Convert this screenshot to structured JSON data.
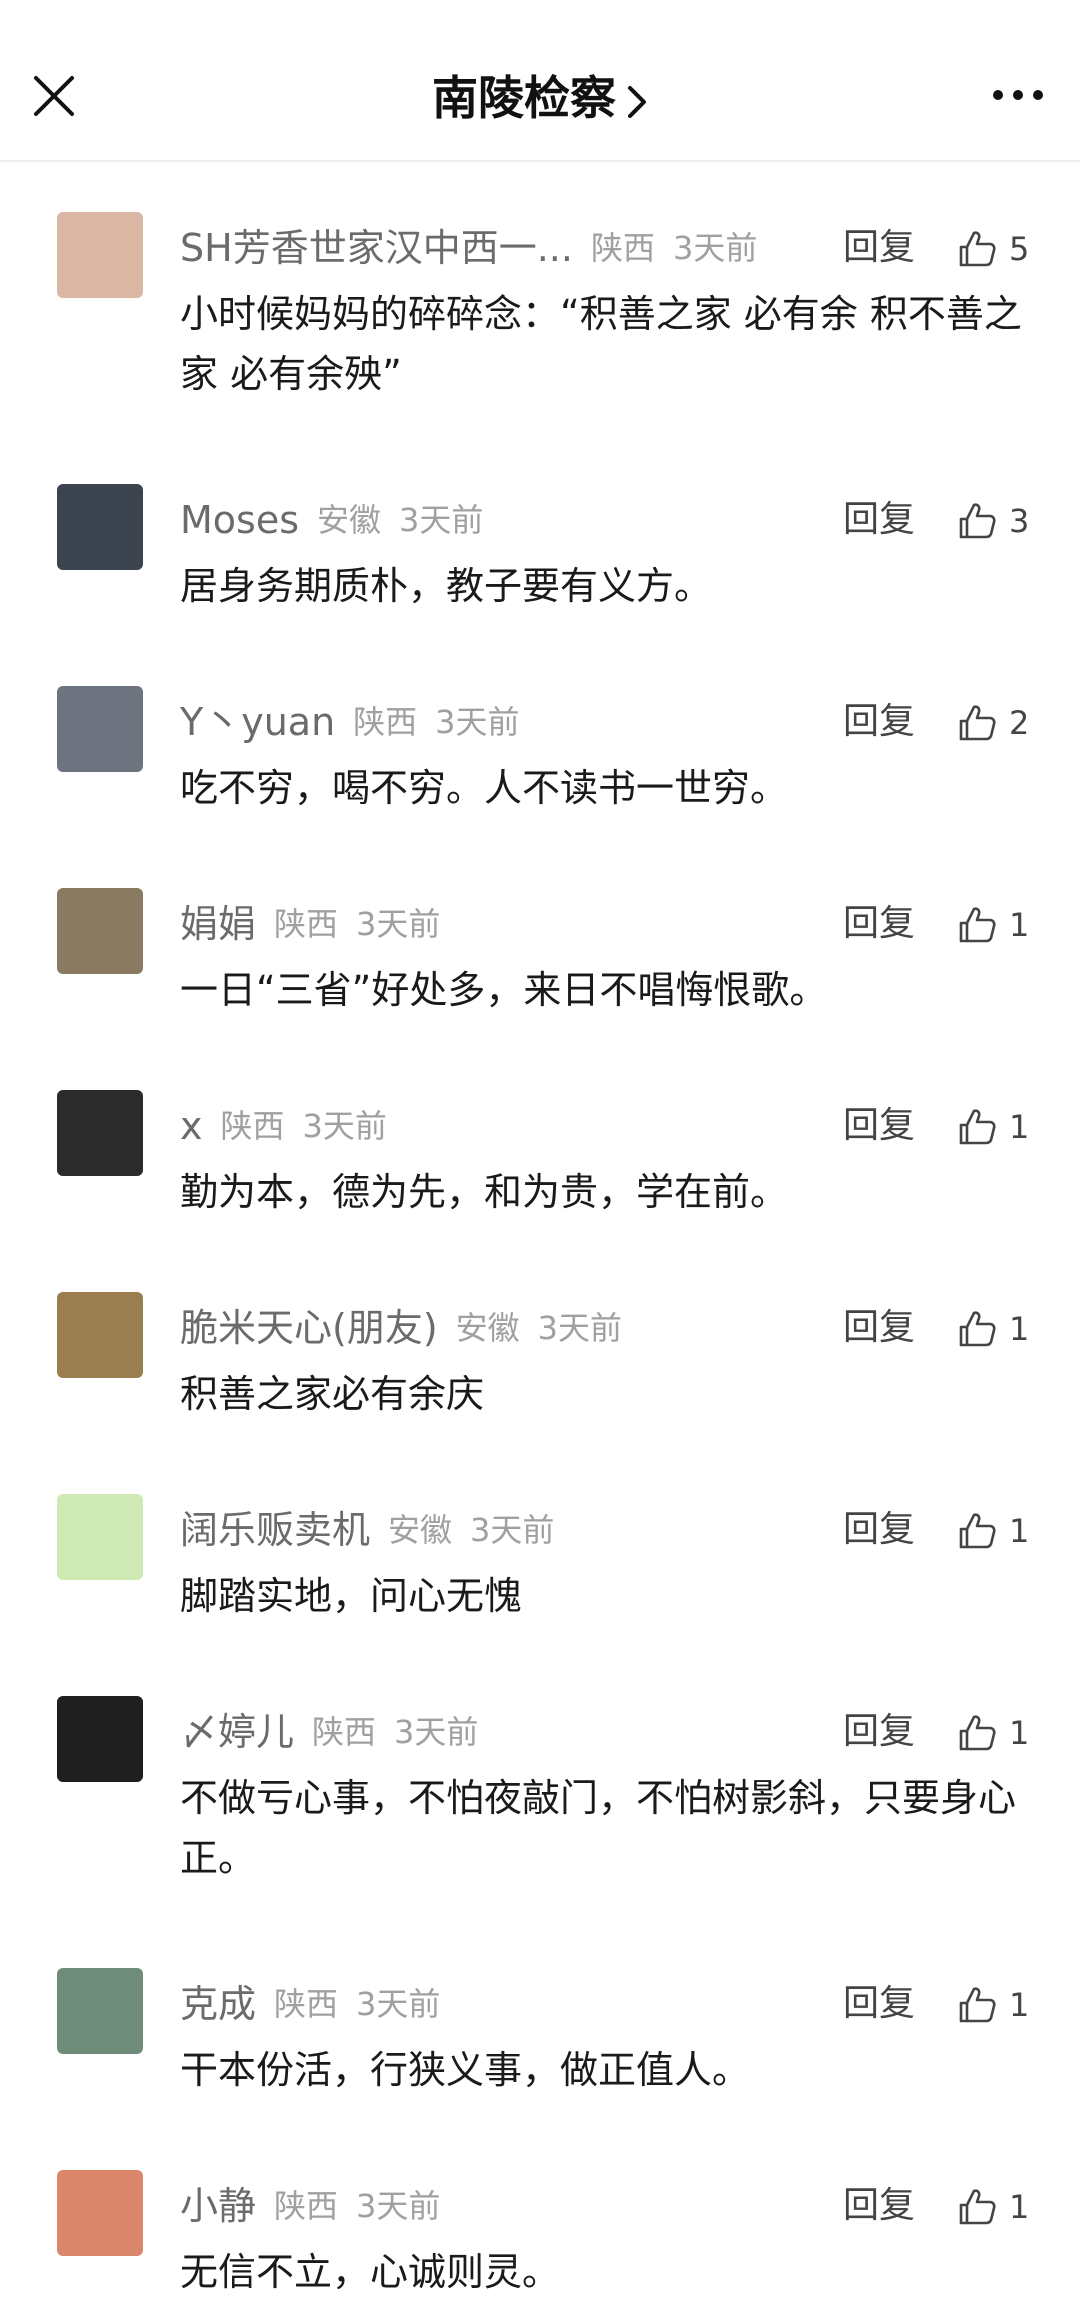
{
  "header": {
    "title": "南陵检察",
    "close_icon": "close-icon",
    "chevron_icon": "chevron-right-icon",
    "more_icon": "more-dots-icon"
  },
  "colors": {
    "text_primary": "#1a1a1a",
    "text_name": "#6b6b6b",
    "text_meta": "#a0a0a0",
    "divider": "#eeeeee"
  },
  "reply_label": "回复",
  "comments": [
    {
      "name": "SH芳香世家汉中西一...",
      "location": "陕西",
      "time": "3天前",
      "likes": "5",
      "text": "小时候妈妈的碎碎念：“积善之家 必有余 积不善之家 必有余殃”",
      "avatar_color": "#d9b7a3"
    },
    {
      "name": "Moses",
      "location": "安徽",
      "time": "3天前",
      "likes": "3",
      "text": "居身务期质朴，教子要有义方。",
      "avatar_color": "#3c4450"
    },
    {
      "name": "Y丶yuan",
      "location": "陕西",
      "time": "3天前",
      "likes": "2",
      "text": "吃不穷，喝不穷。人不读书一世穷。",
      "avatar_color": "#6d7480"
    },
    {
      "name": "娟娟",
      "location": "陕西",
      "time": "3天前",
      "likes": "1",
      "text": "一日“三省”好处多，来日不唱悔恨歌。",
      "avatar_color": "#8a7a62"
    },
    {
      "name": "x",
      "location": "陕西",
      "time": "3天前",
      "likes": "1",
      "text": "勤为本，德为先，和为贵，学在前。",
      "avatar_color": "#2b2b2b"
    },
    {
      "name": "脆米天心(朋友)",
      "location": "安徽",
      "time": "3天前",
      "likes": "1",
      "text": "积善之家必有余庆",
      "avatar_color": "#9b7e4f"
    },
    {
      "name": "阔乐贩卖机",
      "location": "安徽",
      "time": "3天前",
      "likes": "1",
      "text": "脚踏实地，问心无愧",
      "avatar_color": "#cfe9b5"
    },
    {
      "name": "〆婷儿",
      "location": "陕西",
      "time": "3天前",
      "likes": "1",
      "text": "不做亏心事，不怕夜敲门，不怕树影斜，只要身心正。",
      "avatar_color": "#1f1f1f"
    },
    {
      "name": "克成",
      "location": "陕西",
      "time": "3天前",
      "likes": "1",
      "text": "干本份活，行狭义事，做正值人。",
      "avatar_color": "#6f8c7a"
    },
    {
      "name": "小静",
      "location": "陕西",
      "time": "3天前",
      "likes": "1",
      "text": "无信不立，心诚则灵。",
      "avatar_color": "#d9866b"
    }
  ]
}
